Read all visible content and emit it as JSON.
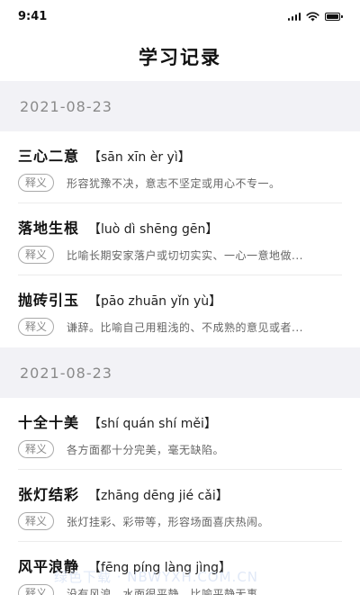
{
  "status_bar": {
    "time": "9:41"
  },
  "nav": {
    "title": "学习记录"
  },
  "sections": [
    {
      "date": "2021-08-23",
      "entries": [
        {
          "word": "三心二意",
          "pinyin": "【sān xīn èr yì】",
          "tag": "释义",
          "definition": "形容犹豫不决，意志不坚定或用心不专一。"
        },
        {
          "word": "落地生根",
          "pinyin": "【luò dì shēng gēn】",
          "tag": "释义",
          "definition": "比喻长期安家落户或切切实实、一心一意地做..."
        },
        {
          "word": "抛砖引玉",
          "pinyin": "【pāo zhuān yǐn yù】",
          "tag": "释义",
          "definition": "谦辞。比喻自己用粗浅的、不成熟的意见或者..."
        }
      ]
    },
    {
      "date": "2021-08-23",
      "entries": [
        {
          "word": "十全十美",
          "pinyin": "【shí quán shí měi】",
          "tag": "释义",
          "definition": "各方面都十分完美，毫无缺陷。"
        },
        {
          "word": "张灯结彩",
          "pinyin": "【zhāng dēng jié cǎi】",
          "tag": "释义",
          "definition": "张灯挂彩、彩带等，形容场面喜庆热闹。"
        },
        {
          "word": "风平浪静",
          "pinyin": "【fēng píng làng jìng】",
          "tag": "释义",
          "definition": "没有风浪，水面很平静，比喻平静无事。"
        }
      ]
    }
  ],
  "watermark": {
    "text": "绿色下载 · NBWYXH.COM.CN"
  }
}
